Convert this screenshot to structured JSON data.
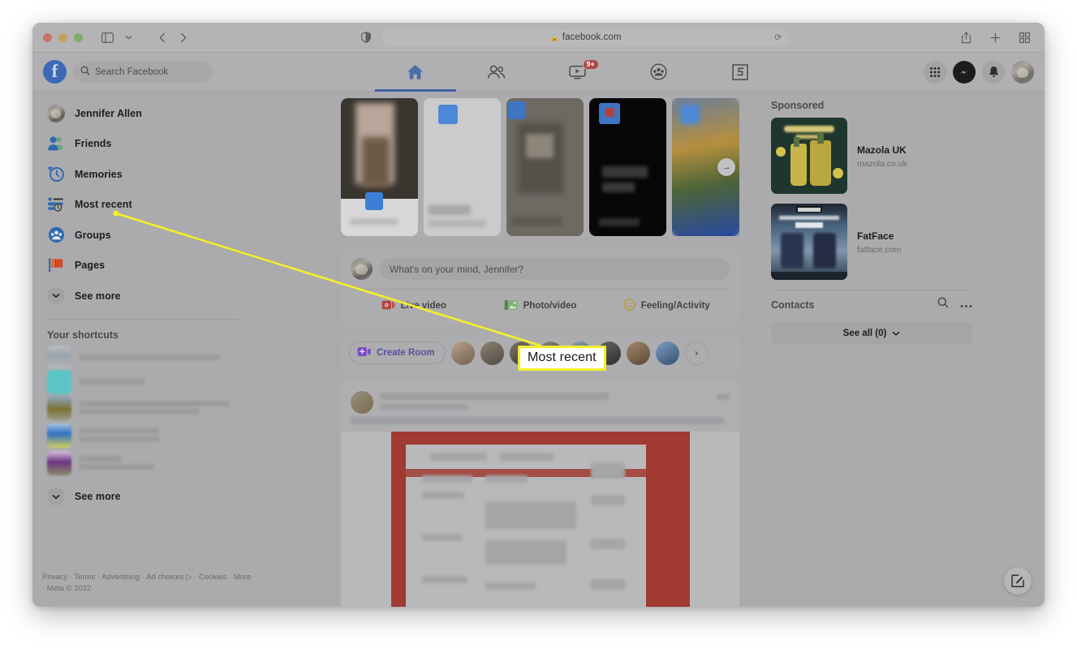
{
  "browser": {
    "traffic_lights": [
      "close",
      "minimize",
      "zoom"
    ],
    "sidebar_toggle_icon": "sidebar-icon",
    "tab_dropdown_icon": "chevron-down-icon",
    "back_icon": "chevron-left-icon",
    "forward_icon": "chevron-right-icon",
    "shield_icon": "privacy-shield-icon",
    "url": "facebook.com",
    "lock_glyph": "🔒",
    "reload_glyph": "⟳",
    "share_icon": "share-icon",
    "new_tab_icon": "plus-icon",
    "tab_overview_icon": "tab-grid-icon"
  },
  "topbar": {
    "logo_letter": "f",
    "search": {
      "placeholder": "Search Facebook",
      "icon": "search-icon"
    },
    "nav": [
      {
        "id": "home",
        "icon": "home-icon",
        "label": "Home",
        "active": true,
        "badge": ""
      },
      {
        "id": "friends",
        "icon": "friends-icon",
        "label": "Friends",
        "active": false,
        "badge": ""
      },
      {
        "id": "watch",
        "icon": "watch-icon",
        "label": "Watch",
        "active": false,
        "badge": "9+"
      },
      {
        "id": "groups",
        "icon": "groups-icon",
        "label": "Groups",
        "active": false,
        "badge": ""
      },
      {
        "id": "gaming",
        "icon": "gaming-icon",
        "label": "Gaming",
        "active": false,
        "badge": ""
      }
    ],
    "actions": [
      {
        "id": "menu",
        "icon": "grid-menu-icon"
      },
      {
        "id": "messenger",
        "icon": "messenger-icon"
      },
      {
        "id": "notifications",
        "icon": "bell-icon"
      },
      {
        "id": "account",
        "icon": "profile-avatar"
      }
    ]
  },
  "sidebar": {
    "items": [
      {
        "label": "Jennifer Allen",
        "icon": "profile-avatar"
      },
      {
        "label": "Friends",
        "icon": "friends-icon"
      },
      {
        "label": "Memories",
        "icon": "memories-clock-icon"
      },
      {
        "label": "Most recent",
        "icon": "most-recent-icon"
      },
      {
        "label": "Groups",
        "icon": "groups-icon"
      },
      {
        "label": "Pages",
        "icon": "pages-flag-icon"
      },
      {
        "label": "See more",
        "icon": "chevron-down-icon"
      }
    ],
    "shortcuts_title": "Your shortcuts",
    "shortcuts": [
      {
        "label": "",
        "color": "#9ba3ab"
      },
      {
        "label": "",
        "color": "#5bc4c6"
      },
      {
        "label": "",
        "color": "#7d7233"
      },
      {
        "label": "",
        "color": "#2f6fc4"
      },
      {
        "label": "",
        "color": "#6c3480"
      }
    ],
    "see_more_bottom": "See more",
    "footer": "Privacy · Terms · Advertising · Ad choices ▷ · Cookies · More · Meta © 2022"
  },
  "feed": {
    "stories": [
      {
        "id": "story-1",
        "bg": "#39352f"
      },
      {
        "id": "story-2",
        "bg": "#c9c9c9"
      },
      {
        "id": "story-3",
        "bg": "#6e6a63"
      },
      {
        "id": "story-4",
        "bg": "#070707"
      },
      {
        "id": "story-5",
        "bg": "#5c6f8e"
      }
    ],
    "stories_next_glyph": "→",
    "composer": {
      "placeholder": "What's on your mind, Jennifer?",
      "actions": [
        {
          "label": "Live video",
          "icon": "live-video-icon",
          "color": "#b2443f"
        },
        {
          "label": "Photo/video",
          "icon": "photo-video-icon",
          "color": "#4e8752"
        },
        {
          "label": "Feeling/Activity",
          "icon": "feeling-icon",
          "color": "#b59a3d"
        }
      ]
    },
    "rooms": {
      "create_label": "Create Room",
      "create_icon": "video-room-icon",
      "next_glyph": "›",
      "avatars": [
        {
          "id": "contact-1",
          "bg": "#8d7d6a"
        },
        {
          "id": "contact-2",
          "bg": "#6c6458"
        },
        {
          "id": "contact-3",
          "bg": "#4f4a42"
        },
        {
          "id": "contact-4",
          "bg": "#5c5a52"
        },
        {
          "id": "contact-5",
          "bg": "#4a5a6b"
        },
        {
          "id": "contact-6",
          "bg": "#3f3d3a"
        },
        {
          "id": "contact-7",
          "bg": "#6e5c4a"
        },
        {
          "id": "contact-8",
          "bg": "#3f5a78"
        }
      ]
    }
  },
  "rail": {
    "sponsored_title": "Sponsored",
    "ads": [
      {
        "name": "Mazola UK",
        "url": "mazola.co.uk",
        "thumb_bg": "#1f362e",
        "thumb_text_top": "SPECIALLY SELECTED",
        "thumb_text_sub": "SINCE 1911"
      },
      {
        "name": "FatFace",
        "url": "fatface.com",
        "thumb_bg": "#2c3a4d",
        "thumb_text_top": "FATFACE",
        "thumb_text_sub": "£55.00"
      }
    ],
    "contacts_title": "Contacts",
    "contacts_search_icon": "search-icon",
    "contacts_more_icon": "ellipsis-icon",
    "see_all_label": "See all (0)",
    "see_all_chevron": "⌄"
  },
  "fab": {
    "icon": "compose-pencil-icon"
  },
  "annotation": {
    "callout_text": "Most recent",
    "line_color": "#f5ef26",
    "callout_border": "#f2ee2a"
  }
}
